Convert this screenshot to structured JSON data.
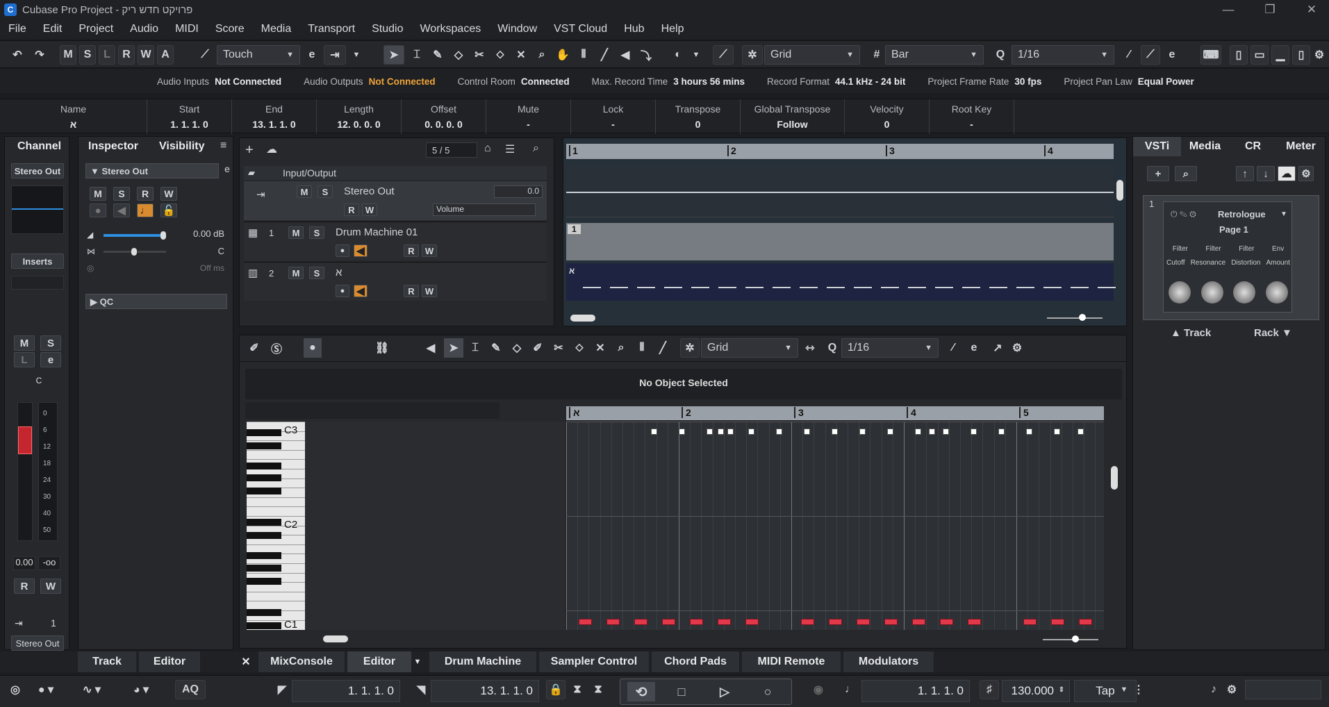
{
  "window": {
    "title": "Cubase Pro Project - פרויקט חדש ריק"
  },
  "menu": [
    "File",
    "Edit",
    "Project",
    "Audio",
    "MIDI",
    "Score",
    "Media",
    "Transport",
    "Studio",
    "Workspaces",
    "Window",
    "VST Cloud",
    "Hub",
    "Help"
  ],
  "toolbar": {
    "m": "M",
    "s": "S",
    "l": "L",
    "r": "R",
    "w": "W",
    "a": "A",
    "automation_mode": "Touch",
    "snap_type": "Grid",
    "grid_type": "Bar",
    "quantize": "1/16"
  },
  "status": {
    "audio_inputs_label": "Audio Inputs",
    "audio_inputs_value": "Not Connected",
    "audio_outputs_label": "Audio Outputs",
    "audio_outputs_value": "Not Connected",
    "control_room_label": "Control Room",
    "control_room_value": "Connected",
    "max_record_label": "Max. Record Time",
    "max_record_value": "3 hours 56 mins",
    "record_format_label": "Record Format",
    "record_format_value": "44.1 kHz - 24 bit",
    "frame_rate_label": "Project Frame Rate",
    "frame_rate_value": "30 fps",
    "pan_law_label": "Project Pan Law",
    "pan_law_value": "Equal Power"
  },
  "infoline": [
    {
      "h": "Name",
      "v": "א"
    },
    {
      "h": "Start",
      "v": "1. 1. 1.   0"
    },
    {
      "h": "End",
      "v": "13. 1. 1.   0"
    },
    {
      "h": "Length",
      "v": "12. 0. 0.   0"
    },
    {
      "h": "Offset",
      "v": "0. 0. 0.   0"
    },
    {
      "h": "Mute",
      "v": "-"
    },
    {
      "h": "Lock",
      "v": "-"
    },
    {
      "h": "Transpose",
      "v": "0"
    },
    {
      "h": "Global Transpose",
      "v": "Follow"
    },
    {
      "h": "Velocity",
      "v": "0"
    },
    {
      "h": "Root Key",
      "v": "-"
    }
  ],
  "channel": {
    "tab": "Channel",
    "output": "Stereo Out",
    "inserts": "Inserts",
    "m": "M",
    "s": "S",
    "l": "L",
    "r": "R",
    "w": "W",
    "pan": "C",
    "vol": "0.00",
    "peak": "-oo",
    "route_num": "1",
    "bottom_out": "Stereo Out",
    "scale": [
      "0",
      "6",
      "12",
      "18",
      "24",
      "30",
      "40",
      "50"
    ]
  },
  "inspector": {
    "tab": "Inspector",
    "tab2": "Visibility",
    "track": "Stereo Out",
    "m": "M",
    "s": "S",
    "r": "R",
    "w": "W",
    "vol": "0.00 dB",
    "pan": "C",
    "delay": "Off ms",
    "qc": "QC"
  },
  "project": {
    "count": "5 / 5",
    "folder": "Input/Output",
    "tracks": [
      {
        "num": "",
        "name": "Stereo Out",
        "vol": "0.0",
        "param": "Volume"
      },
      {
        "num": "1",
        "name": "Drum Machine 01"
      },
      {
        "num": "2",
        "name": "א"
      }
    ],
    "ruler": [
      "1",
      "2",
      "3",
      "4"
    ],
    "event_label": "1",
    "part_label": "א",
    "m": "M",
    "s": "S",
    "r": "R",
    "w": "W"
  },
  "editor": {
    "snap": "Grid",
    "quantize": "1/16",
    "no_selection": "No Object Selected",
    "ruler": [
      "א",
      "2",
      "3",
      "4",
      "5"
    ],
    "keys": [
      "C3",
      "C2",
      "C1"
    ]
  },
  "vsti": {
    "tabs": [
      "VSTi",
      "Media",
      "CR",
      "Meter"
    ],
    "slot": "1",
    "instrument": "Retrologue",
    "page": "Page 1",
    "params_top": [
      "Filter",
      "Filter",
      "Filter",
      "Env"
    ],
    "params_bot": [
      "Cutoff",
      "Resonance",
      "Distortion",
      "Amount"
    ],
    "track": "Track",
    "rack": "Rack"
  },
  "bottom_tabs": {
    "track": "Track",
    "editor": "Editor",
    "mix": "MixConsole",
    "editor2": "Editor",
    "drum": "Drum Machine",
    "sampler": "Sampler Control",
    "chord": "Chord Pads",
    "midi_remote": "MIDI Remote",
    "mod": "Modulators"
  },
  "transport": {
    "aq": "AQ",
    "left": "1. 1. 1.   0",
    "right": "13. 1. 1.   0",
    "pos": "1. 1. 1.   0",
    "tempo": "130.000",
    "tap": "Tap"
  }
}
